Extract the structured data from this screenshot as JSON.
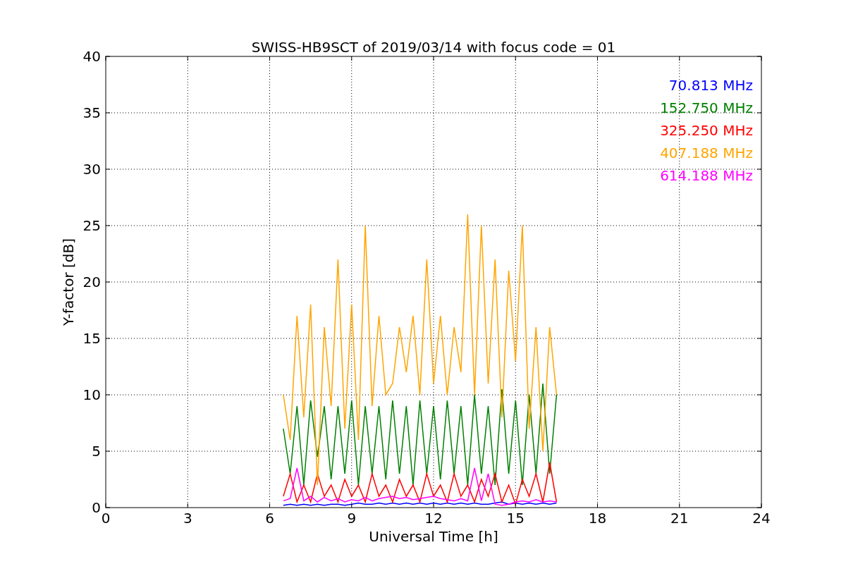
{
  "chart_data": {
    "type": "line",
    "title": "SWISS-HB9SCT of 2019/03/14 with focus code = 01",
    "xlabel": "Universal Time [h]",
    "ylabel": "Y-factor [dB]",
    "grid": true,
    "xlim": [
      0,
      24
    ],
    "ylim": [
      0,
      40
    ],
    "xticks": [
      0,
      3,
      6,
      9,
      12,
      15,
      18,
      21,
      24
    ],
    "yticks": [
      0,
      5,
      10,
      15,
      20,
      25,
      30,
      35,
      40
    ],
    "x": [
      6.5,
      6.75,
      7,
      7.25,
      7.5,
      7.75,
      8,
      8.25,
      8.5,
      8.75,
      9,
      9.25,
      9.5,
      9.75,
      10,
      10.25,
      10.5,
      10.75,
      11,
      11.25,
      11.5,
      11.75,
      12,
      12.25,
      12.5,
      12.75,
      13,
      13.25,
      13.5,
      13.75,
      14,
      14.25,
      14.5,
      14.75,
      15,
      15.25,
      15.5,
      15.75,
      16,
      16.25,
      16.5
    ],
    "series": [
      {
        "name": "70.813 MHz",
        "color": "#0000ff",
        "values": [
          0.2,
          0.3,
          0.2,
          0.3,
          0.2,
          0.3,
          0.2,
          0.3,
          0.3,
          0.2,
          0.3,
          0.4,
          0.3,
          0.3,
          0.4,
          0.3,
          0.4,
          0.3,
          0.4,
          0.3,
          0.4,
          0.3,
          0.4,
          0.3,
          0.4,
          0.3,
          0.4,
          0.3,
          0.4,
          0.3,
          0.3,
          0.4,
          0.5,
          0.3,
          0.4,
          0.3,
          0.4,
          0.3,
          0.4,
          0.3,
          0.4
        ]
      },
      {
        "name": "152.750 MHz",
        "color": "#008000",
        "values": [
          7,
          3,
          9,
          2,
          9.5,
          4.5,
          9,
          2.5,
          9,
          3,
          9.5,
          2,
          9,
          3,
          9,
          2.5,
          9.5,
          3,
          9,
          2,
          9.5,
          3,
          9,
          2.5,
          9.5,
          3,
          9,
          2,
          10,
          3,
          9,
          2,
          10.5,
          3,
          9.5,
          2,
          10,
          3,
          11,
          3,
          10
        ]
      },
      {
        "name": "325.250 MHz",
        "color": "#ff0000",
        "values": [
          1,
          3,
          0.5,
          2,
          0.5,
          3,
          1,
          2,
          0.5,
          2.5,
          1,
          2,
          0.5,
          3,
          1,
          2,
          0.5,
          2.5,
          1,
          2,
          0.5,
          3,
          1,
          2,
          0.5,
          3,
          1,
          2,
          0.5,
          2.5,
          1,
          3,
          0.5,
          2,
          0.3,
          2.5,
          1,
          3,
          0.5,
          4,
          0.5
        ]
      },
      {
        "name": "407.188 MHz",
        "color": "#ffa500",
        "values": [
          10,
          6,
          17,
          8,
          18,
          2,
          16,
          9,
          22,
          7,
          18,
          6,
          25,
          9,
          17,
          10,
          11,
          16,
          12,
          17,
          10,
          22,
          11,
          17,
          10,
          16,
          12,
          26,
          10,
          25,
          11,
          22,
          8,
          21,
          13,
          25,
          7,
          16,
          5,
          16,
          10
        ]
      },
      {
        "name": "614.188 MHz",
        "color": "#ff00ff",
        "values": [
          0.6,
          0.8,
          3.5,
          0.6,
          1,
          0.5,
          0.9,
          0.6,
          0.8,
          0.5,
          0.7,
          0.6,
          0.9,
          0.6,
          0.8,
          0.9,
          1,
          0.8,
          0.9,
          0.7,
          0.8,
          0.9,
          1,
          0.8,
          0.7,
          0.6,
          0.8,
          0.6,
          3.5,
          0.6,
          3,
          0.3,
          0.2,
          0.3,
          0.5,
          0.6,
          0.5,
          0.7,
          0.5,
          0.6,
          0.5
        ]
      }
    ]
  }
}
